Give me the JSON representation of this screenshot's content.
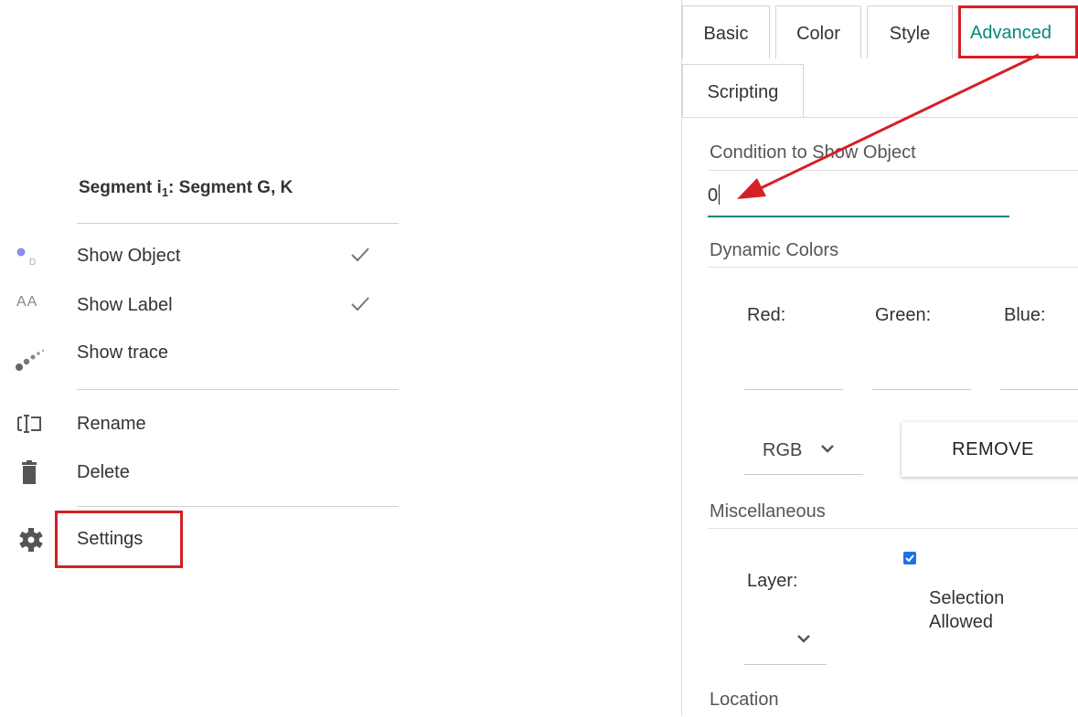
{
  "context_menu": {
    "title_main": "Segment i",
    "title_sub": "1",
    "title_rest": ": Segment G, K",
    "items": [
      {
        "label": "Show Object",
        "icon": "show-object-icon",
        "checked": true
      },
      {
        "label": "Show Label",
        "icon": "show-label-icon",
        "checked": true,
        "icon_text": "AA"
      },
      {
        "label": "Show trace",
        "icon": "show-trace-icon",
        "checked": false
      },
      {
        "label": "Rename",
        "icon": "rename-icon"
      },
      {
        "label": "Delete",
        "icon": "trash-icon"
      },
      {
        "label": "Settings",
        "icon": "gear-icon",
        "highlighted": true
      }
    ]
  },
  "settings_panel": {
    "tabs": [
      {
        "label": "Basic"
      },
      {
        "label": "Color"
      },
      {
        "label": "Style"
      },
      {
        "label": "Advanced",
        "active": true
      },
      {
        "label": "Scripting"
      }
    ],
    "condition": {
      "label": "Condition to Show Object",
      "value": "0"
    },
    "dynamic_colors": {
      "label": "Dynamic Colors",
      "red_label": "Red:",
      "green_label": "Green:",
      "blue_label": "Blue:",
      "mode": "RGB",
      "remove_label": "REMOVE"
    },
    "misc": {
      "label": "Miscellaneous",
      "layer_label": "Layer:",
      "selection_allowed_line1": "Selection",
      "selection_allowed_line2": "Allowed",
      "selection_allowed": true
    },
    "location": {
      "label": "Location"
    }
  },
  "colors": {
    "accent": "#00897b",
    "highlight": "#d61f26",
    "checkbox": "#1a73e8"
  }
}
